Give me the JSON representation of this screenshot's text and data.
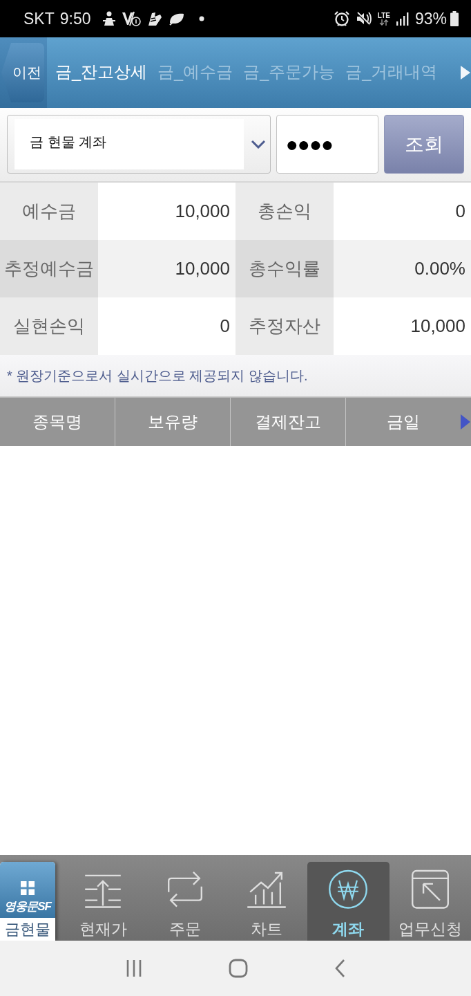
{
  "status_bar": {
    "carrier": "SKT",
    "time": "9:50",
    "network": "LTE",
    "battery": "93%"
  },
  "header": {
    "back_button": "이전",
    "tabs": [
      {
        "label": "금_잔고상세",
        "selected": true
      },
      {
        "label": "금_예수금",
        "selected": false
      },
      {
        "label": "금_주문가능",
        "selected": false
      },
      {
        "label": "금_거래내역",
        "selected": false
      }
    ]
  },
  "account": {
    "account_select": "금 현물 계좌",
    "password": "●●●●",
    "query_button": "조회"
  },
  "summary": [
    {
      "label": "예수금",
      "value": "10,000"
    },
    {
      "label": "총손익",
      "value": "0"
    },
    {
      "label": "추정예수금",
      "value": "10,000"
    },
    {
      "label": "총수익률",
      "value": "0.00%"
    },
    {
      "label": "실현손익",
      "value": "0"
    },
    {
      "label": "추정자산",
      "value": "10,000"
    }
  ],
  "note": "* 원장기준으로서 실시간으로 제공되지 않습니다.",
  "table": {
    "columns": [
      "종목명",
      "보유량",
      "결제잔고",
      "금일"
    ]
  },
  "bottom_nav": {
    "app_tile": {
      "logo": "영웅문SF",
      "label": "금현물"
    },
    "items": [
      {
        "label": "현재가",
        "kind": "price",
        "selected": false
      },
      {
        "label": "주문",
        "kind": "order",
        "selected": false
      },
      {
        "label": "차트",
        "kind": "chart",
        "selected": false
      },
      {
        "label": "계좌",
        "kind": "account",
        "selected": true
      },
      {
        "label": "업무신청",
        "kind": "request",
        "selected": false
      }
    ]
  }
}
